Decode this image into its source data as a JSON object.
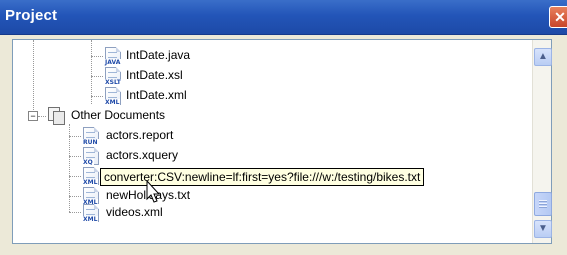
{
  "window": {
    "title": "Project",
    "close_glyph": "✕"
  },
  "tree": {
    "items": [
      {
        "label": "IntDate.java",
        "icon": "java-file-icon",
        "tag": "JAVA"
      },
      {
        "label": "IntDate.xsl",
        "icon": "xslt-file-icon",
        "tag": "XSLT"
      },
      {
        "label": "IntDate.xml",
        "icon": "xml-file-icon",
        "tag": "XML"
      },
      {
        "label": "Other Documents",
        "icon": "folder-icon",
        "expander": "−"
      },
      {
        "label": "actors.report",
        "icon": "report-file-icon",
        "tag": "RUN"
      },
      {
        "label": "actors.xquery",
        "icon": "xquery-file-icon",
        "tag": "XQ"
      },
      {
        "label": "",
        "icon": "xml-file-icon",
        "tag": "XML"
      },
      {
        "label": "newHolidays.txt",
        "icon": "text-file-icon",
        "tag": "XML"
      },
      {
        "label": "videos.xml",
        "icon": "xml-file-icon",
        "tag": "XML"
      }
    ]
  },
  "tooltip": {
    "text": "converter:CSV:newline=lf:first=yes?file:///w:/testing/bikes.txt"
  },
  "scrollbar": {
    "up_glyph": "▲",
    "down_glyph": "▼"
  },
  "colors": {
    "titlebar": "#2355b8",
    "tooltip_bg": "#ffffe1"
  }
}
